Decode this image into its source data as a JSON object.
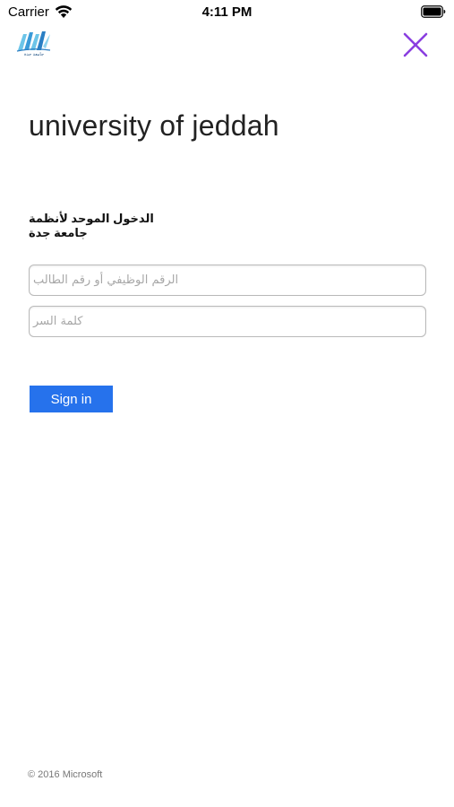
{
  "status_bar": {
    "carrier": "Carrier",
    "time": "4:11 PM",
    "wifi_icon": "wifi-icon",
    "battery_icon": "battery-full-icon"
  },
  "header": {
    "logo_icon": "university-logo-icon",
    "logo_caption": "جامعة جدة",
    "close_icon": "close-icon",
    "close_color": "#8a3ee0"
  },
  "brand": {
    "title": "university of jeddah",
    "subtitle": "الدخول الموحد لأنظمة جامعة جدة"
  },
  "form": {
    "username": {
      "value": "",
      "placeholder": "الرقم الوظيفي أو رقم الطالب"
    },
    "password": {
      "value": "",
      "placeholder": "كلمة السر"
    },
    "submit_label": "Sign in",
    "accent_color": "#2672ec"
  },
  "footer": {
    "copyright": "© 2016 Microsoft"
  }
}
